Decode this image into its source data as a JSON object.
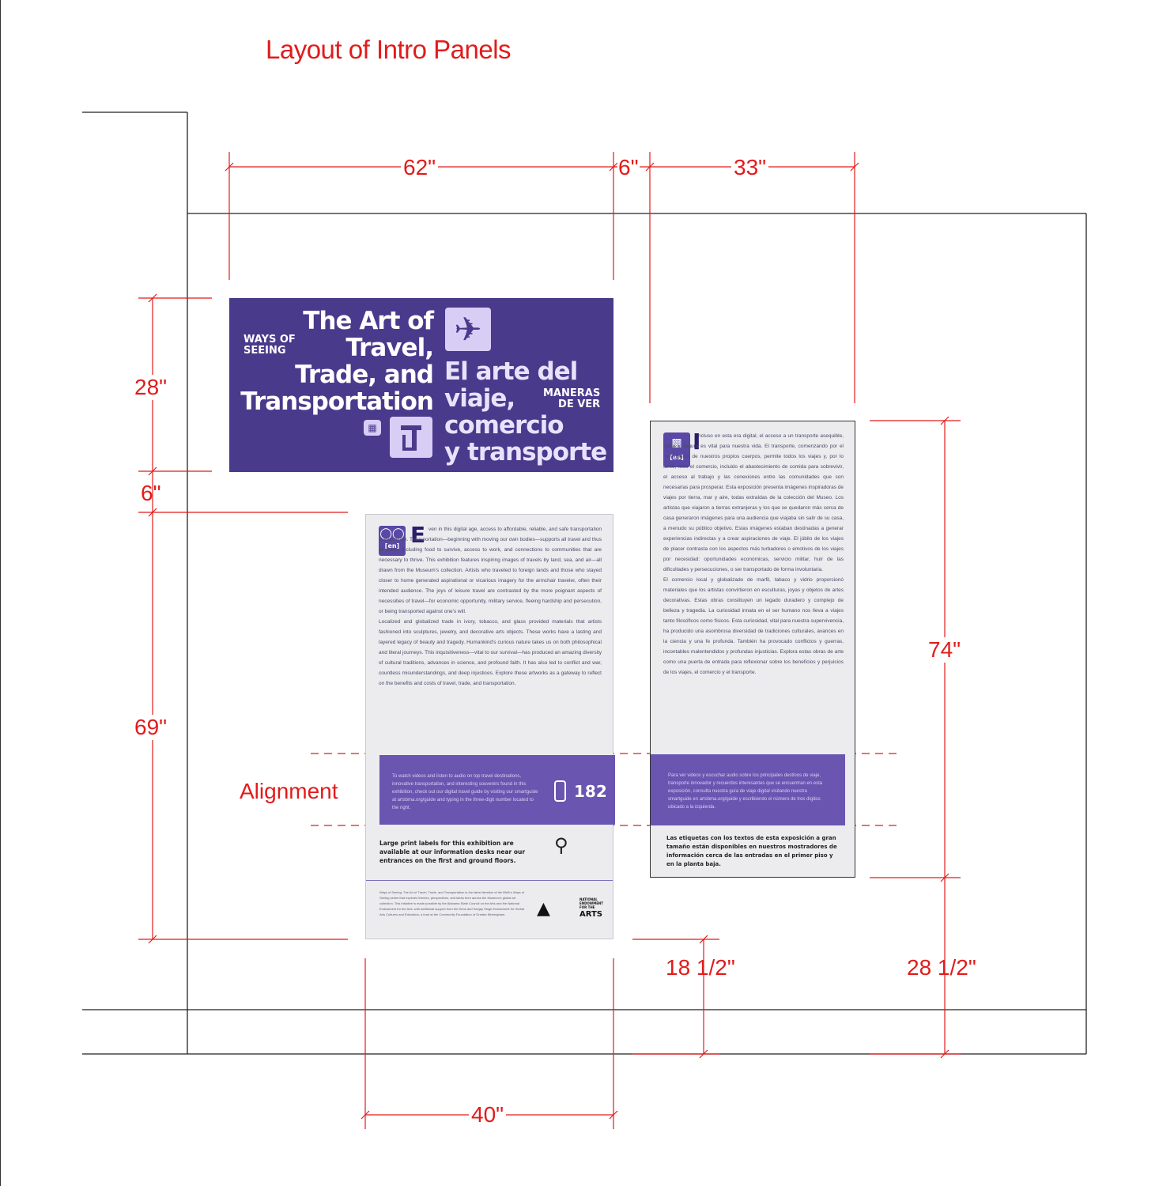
{
  "title": "Layout of Intro Panels",
  "dimensions": {
    "title_panel_width": "62\"",
    "gap_width": "6\"",
    "spanish_panel_width": "33\"",
    "title_panel_height": "28\"",
    "gap_height": "6\"",
    "english_panel_height": "69\"",
    "spanish_panel_height": "74\"",
    "english_panel_floor": "18 1/2\"",
    "spanish_panel_floor": "28 1/2\"",
    "english_panel_width": "40\""
  },
  "alignment_label": "Alignment",
  "title_panel": {
    "ways_of_seeing": "WAYS OF\nSEEING",
    "english_title": "The Art of\nTravel,\nTrade, and\nTransportation",
    "spanish_title": "El arte del\nviaje,\ncomercio\ny transporte",
    "maneras_de_ver": "MANERAS\nDE VER"
  },
  "english_panel": {
    "lang_code": "[en]",
    "drop_cap": "E",
    "body": "ven in this digital age, access to affordable, reliable, and safe transportation is vital to life. Transportation—beginning with moving our own bodies—supports all travel and thus all trade, including food to survive, access to work, and connections to communities that are necessary to thrive. This exhibition features inspiring images of travels by land, sea, and air—all drawn from the Museum's collection. Artists who traveled to foreign lands and those who stayed closer to home generated aspirational or vicarious imagery for the armchair traveler, often their intended audience. The joys of leisure travel are contrasted by the more poignant aspects of necessities of travel—for economic opportunity, military service, fleeing hardship and persecution, or being transported against one's will.\n    Localized and globalized trade in ivory, tobacco, and glass provided materials that artists fashioned into sculptures, jewelry, and decorative arts objects. These works have a lasting and layered legacy of beauty and tragedy. Humankind's curious nature takes us on both philosophical and literal journeys. This inquisitiveness—vital to our survival—has produced an amazing diversity of cultural traditions, advances in science, and profound faith. It has also led to conflict and war, countless misunderstandings, and deep injustices. Explore these artworks as a gateway to reflect on the benefits and costs of travel, trade, and transportation.",
    "guide_text": "To watch videos and listen to audio on top travel destinations, innovative transportation, and interesting souvenirs found in this exhibition, check out our digital travel guide by visiting our smartguide at artsbma.org/guide and typing in the three-digit number located to the right.",
    "guide_number": "182",
    "large_print": "Large print labels for this exhibition are available at our information desks near our entrances on the first and ground floors.",
    "credits": "Ways of Seeing: The Art of Travel, Trade, and Transportation is the latest iteration of the BMA's Ways of Seeing series that explores themes, perspectives, and ideas from across the Museum's global art collection. This initiative is made possible by the Alabama State Council on the Arts and the National Endowment for the Arts, with additional support from the Drew and Sanjay Singh Endowment for Global Arts Cultures and Education, a fund at the Community Foundation of Greater Birmingham."
  },
  "spanish_panel": {
    "lang_code": "[es]",
    "drop_cap": "I",
    "body": "ncluso en esta era digital, el acceso a un transporte asequible, fiable y seguro es vital para nuestra vida. El transporte, comenzando por el movimiento de nuestros propios cuerpos, permite todos los viajes y, por lo tanto, todo el comercio, incluido el abastecimiento de comida para sobrevivir, el acceso al trabajo y las conexiones entre las comunidades que son necesarias para prosperar. Esta exposición presenta imágenes inspiradoras de viajes por tierra, mar y aire, todas extraídas de la colección del Museo. Los artistas que viajaron a tierras extranjeras y los que se quedaron más cerca de casa generaron imágenes para una audiencia que viajaba sin salir de su casa, a menudo su público objetivo. Estas imágenes estaban destinadas a generar experiencias indirectas y a crear aspiraciones de viaje. El júbilo de los viajes de placer contrasta con los aspectos más turbadores o emotivos de los viajes por necesidad: oportunidades económicas, servicio militar, huir de las dificultades y persecuciones, o ser transportado de forma involuntaria.\n    El comercio local y globalizado de marfil, tabaco y vidrio proporcionó materiales que los artistas convirtieron en esculturas, joyas y objetos de artes decorativas. Estas obras constituyen un legado duradero y complejo de belleza y tragedia. La curiosidad innata en el ser humano nos lleva a viajes tanto filosóficos como físicos. Esta curiosidad, vital para nuestra supervivencia, ha producido una asombrosa diversidad de tradiciones culturales, avances en la ciencia y una fe profunda. También ha provocado conflictos y guerras, incontables malentendidos y profundas injusticias. Explora estas obras de arte como una puerta de entrada para reflexionar sobre los beneficios y perjuicios de los viajes, el comercio y el transporte.",
    "guide_text": "Para ver videos y escuchar audio sobre los principales destinos de viaje, transporte innovador y recuerdos interesantes que se encuentran en esta exposición, consulta nuestra guía de viaje digital visitando nuestra smartguide en artsbma.org/guide y escribiendo el número de tres dígitos ubicado a la izquierda.",
    "large_print": "Las etiquetas con los textos de esta exposición a gran tamaño están disponibles en nuestros mostradores de información cerca de las entradas en el primer piso y en la planta baja."
  },
  "logos": {
    "arts": "ARTS",
    "national": "NATIONAL\nENDOWMENT\nFOR THE"
  },
  "colors": {
    "annotation_red": "#e21b1b",
    "panel_purple": "#4a3a8c",
    "band_purple": "#6a55b0",
    "panel_gray": "#ececef"
  }
}
